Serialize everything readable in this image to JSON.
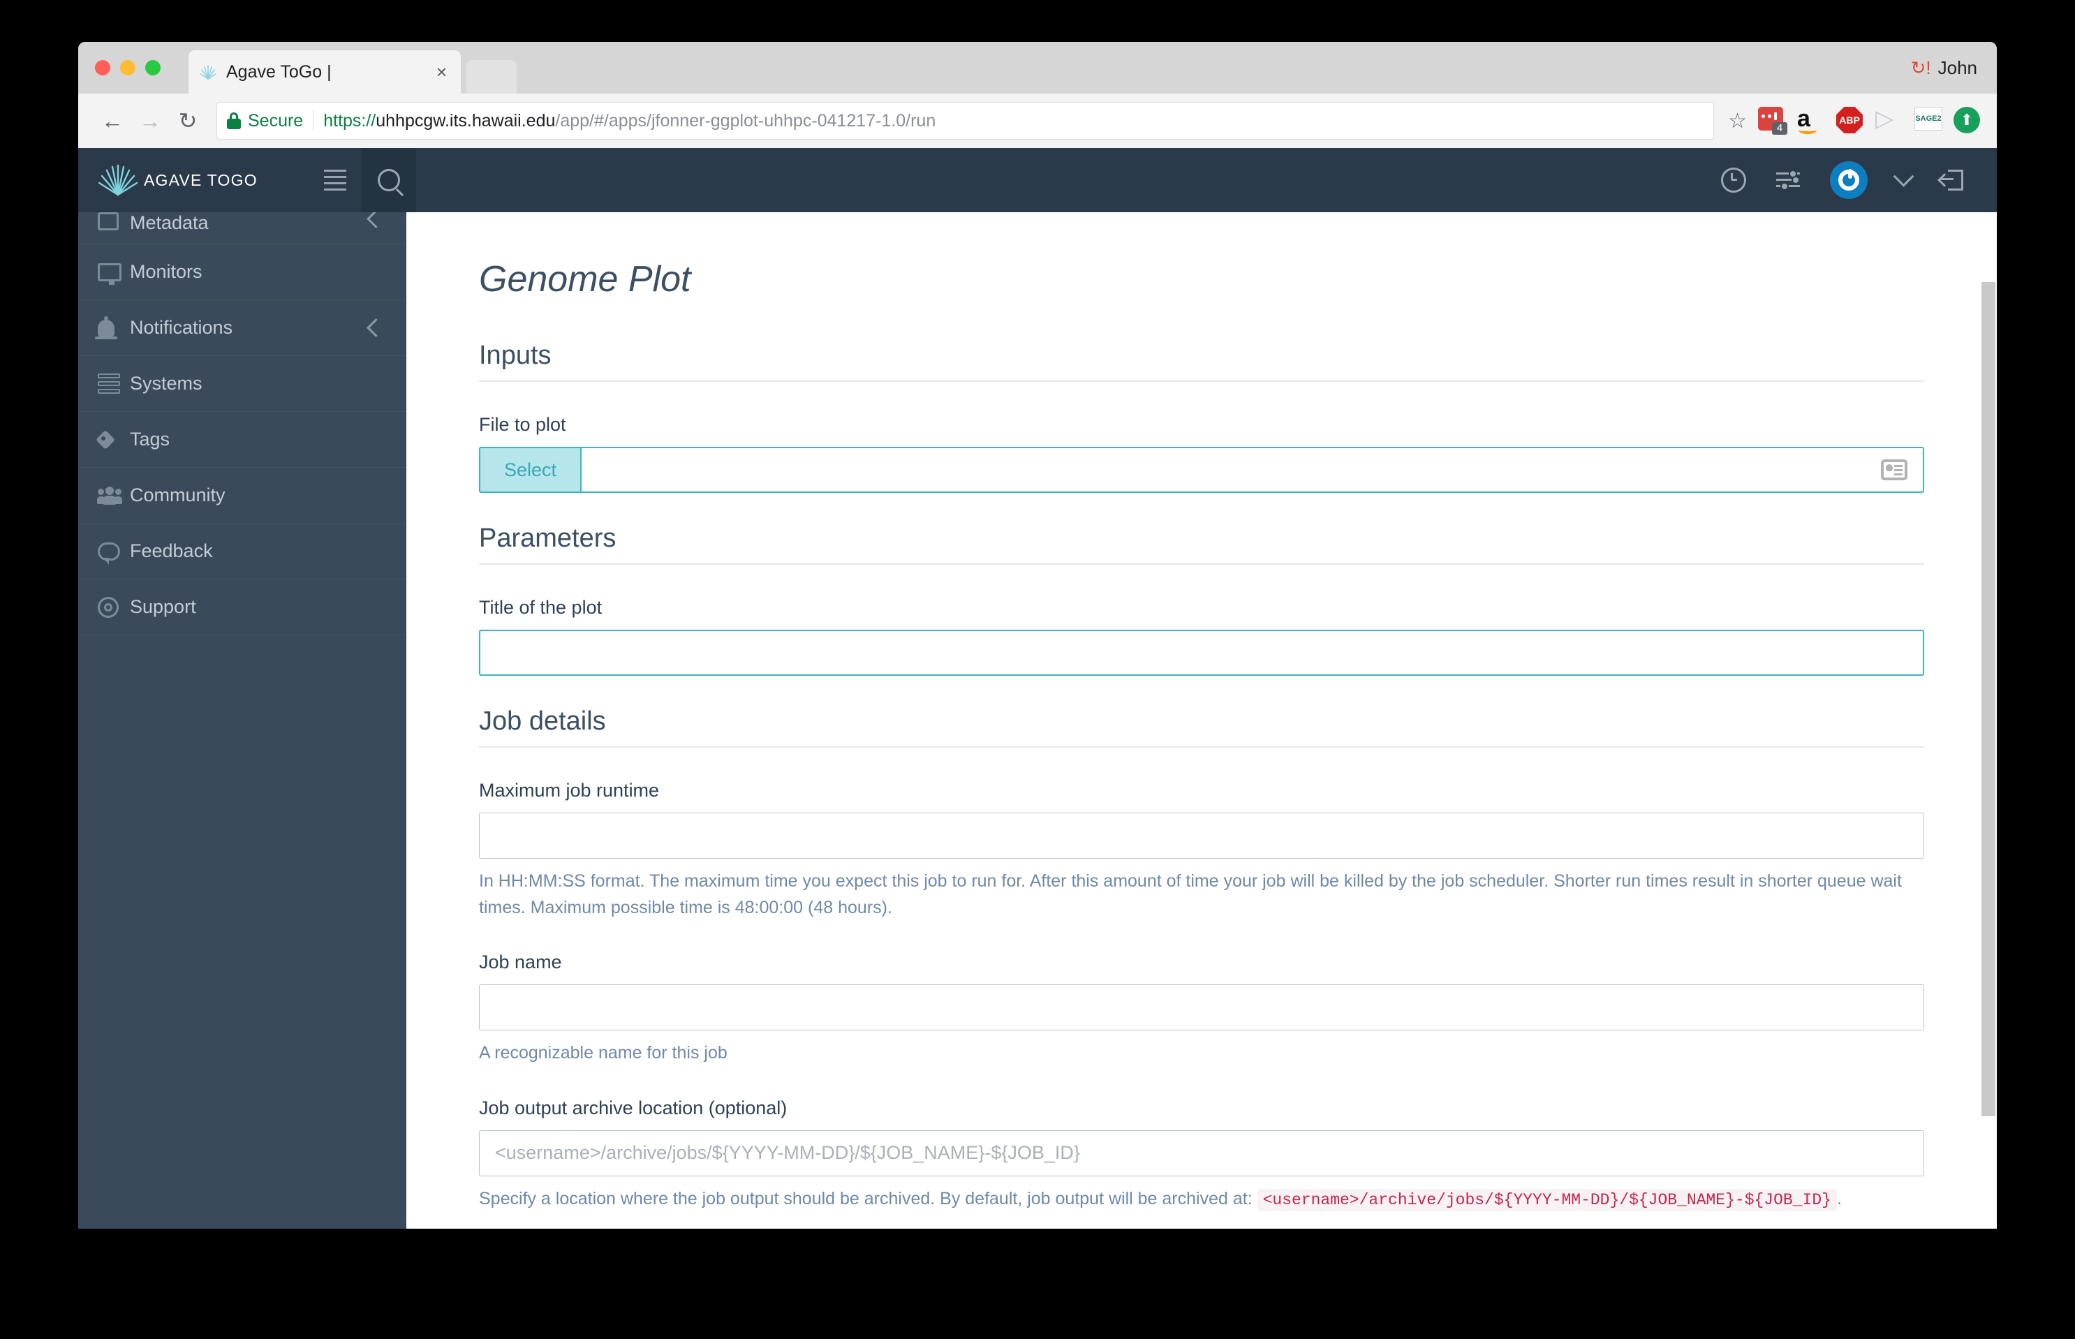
{
  "browser": {
    "tab": {
      "title": "Agave ToGo |",
      "close_label": "×",
      "favicon_name": "agave-favicon"
    },
    "profile": {
      "name": "John",
      "sync_icon": "sync-problem-icon"
    },
    "nav": {
      "back": "←",
      "forward": "→",
      "reload": "↻"
    },
    "omnibox": {
      "security_label": "Secure",
      "url_scheme": "https://",
      "url_host": "uhhpcgw.its.hawaii.edu",
      "url_path": "/app/#/apps/jfonner-ggplot-uhhpc-041217-1.0/run",
      "bookmark_icon": "star-icon"
    },
    "extensions": [
      {
        "name": "tab-manager-extension",
        "badge": "4"
      },
      {
        "name": "amazon-extension",
        "glyph": "a"
      },
      {
        "name": "adblock-plus-extension",
        "glyph": "ABP"
      },
      {
        "name": "media-player-extension",
        "glyph": "▷"
      },
      {
        "name": "sage2-extension",
        "glyph": "SAGE2"
      },
      {
        "name": "upload-extension",
        "glyph": "⬆"
      }
    ]
  },
  "app": {
    "brand": "AGAVE TOGO",
    "header_icons": [
      {
        "name": "history-clock-icon"
      },
      {
        "name": "settings-sliders-icon"
      },
      {
        "name": "user-avatar"
      },
      {
        "name": "chevron-down-icon"
      },
      {
        "name": "logout-icon"
      }
    ],
    "sidebar": [
      {
        "label": "Metadata",
        "icon": "metadata-icon",
        "chevron": true,
        "partial": true
      },
      {
        "label": "Monitors",
        "icon": "monitor-icon",
        "chevron": false
      },
      {
        "label": "Notifications",
        "icon": "bell-icon",
        "chevron": true
      },
      {
        "label": "Systems",
        "icon": "server-icon",
        "chevron": false
      },
      {
        "label": "Tags",
        "icon": "tag-icon",
        "chevron": false
      },
      {
        "label": "Community",
        "icon": "users-icon",
        "chevron": false
      },
      {
        "label": "Feedback",
        "icon": "chat-bubble-icon",
        "chevron": false
      },
      {
        "label": "Support",
        "icon": "lifebuoy-icon",
        "chevron": false
      }
    ]
  },
  "page": {
    "title": "Genome Plot",
    "sections": {
      "inputs": {
        "heading": "Inputs",
        "file_to_plot": {
          "label": "File to plot",
          "select_button": "Select",
          "value": "",
          "placeholder": "",
          "right_icon": "address-card-icon"
        }
      },
      "parameters": {
        "heading": "Parameters",
        "plot_title": {
          "label": "Title of the plot",
          "value": "",
          "placeholder": ""
        }
      },
      "job_details": {
        "heading": "Job details",
        "max_runtime": {
          "label": "Maximum job runtime",
          "value": "",
          "placeholder": "",
          "help": "In HH:MM:SS format. The maximum time you expect this job to run for. After this amount of time your job will be killed by the job scheduler. Shorter run times result in shorter queue wait times. Maximum possible time is 48:00:00 (48 hours)."
        },
        "job_name": {
          "label": "Job name",
          "value": "",
          "placeholder": "",
          "help": "A recognizable name for this job"
        },
        "archive_location": {
          "label": "Job output archive location (optional)",
          "value": "",
          "placeholder": "<username>/archive/jobs/${YYYY-MM-DD}/${JOB_NAME}-${JOB_ID}",
          "help_prefix": "Specify a location where the job output should be archived. By default, job output will be archived at:",
          "help_code": "<username>/archive/jobs/${YYYY-MM-DD}/${JOB_NAME}-${JOB_ID}",
          "help_suffix": "."
        },
        "submit_button": ""
      }
    }
  },
  "colors": {
    "app_header": "#2b3a4a",
    "sidebar": "#3b4a5a",
    "accent_teal": "#37b6c4",
    "primary_blue": "#3a7fc0",
    "code_red": "#c7254e",
    "help_blue": "#7089a8"
  }
}
